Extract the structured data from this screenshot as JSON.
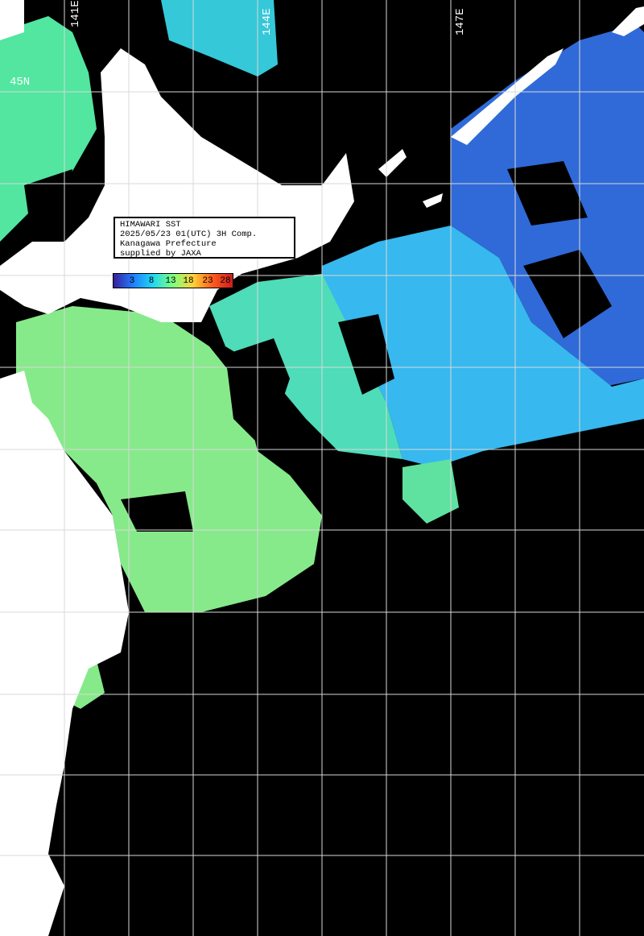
{
  "info": {
    "line1": "HIMAWARI SST",
    "line2": "2025/05/23 01(UTC) 3H Comp.",
    "line3": "Kanagawa Prefecture",
    "line4": "supplied by JAXA"
  },
  "legend": {
    "ticks": [
      "3",
      "8",
      "13",
      "18",
      "23",
      "28"
    ],
    "colors": [
      "#3a1e9a",
      "#1f7fff",
      "#22d8f0",
      "#7fff7f",
      "#ffd33a",
      "#ff5a1e",
      "#c81e1e"
    ]
  },
  "grid_labels": {
    "lat": "45N",
    "lon_a": "144E",
    "lon_b": "147E",
    "lon_c": "141E"
  },
  "colors": {
    "land": "#ffffff",
    "ocean_nodata": "#000000",
    "grid": "#d8d8d8",
    "cold": "#2a6fd8",
    "mid": "#33c9f0",
    "warm": "#7fef7f"
  }
}
